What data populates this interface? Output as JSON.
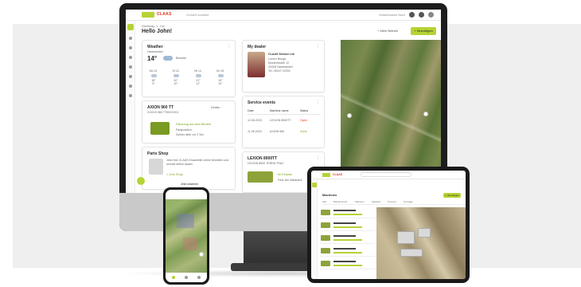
{
  "colors": {
    "accent": "#b5d334",
    "brand": "#e2311d",
    "bezel": "#1d1d1d"
  },
  "monitor": {
    "brand": "CLAAS",
    "topbar_text": "CLAAS connect",
    "topbar_right": "Vorkenbusch Nord",
    "greeting_small": "Samstag, 1. Juli",
    "greeting": "Hello John!",
    "btn_secondary": "+ Mein Betrieb",
    "btn_primary": "+ Hinzufügen",
    "weather": {
      "title": "Weather",
      "location": "Harsewinkel",
      "temp": "14°",
      "cond": "Bewölkt"
    },
    "weather_days": [
      {
        "day": "Mo 12.",
        "hi": "18°",
        "lo": "9°"
      },
      {
        "day": "Di 13.",
        "hi": "20°",
        "lo": "10°"
      },
      {
        "day": "Mi 14.",
        "hi": "21°",
        "lo": "11°"
      },
      {
        "day": "Do 15.",
        "hi": "19°",
        "lo": "10°"
      }
    ],
    "machine": {
      "title": "AXION 960 TT",
      "sub": "XXXXX 960 TT00XXX01",
      "status": "Parkposition",
      "link": "Details",
      "lime": "Fahrzeug auf dem Betrieb",
      "note": "Zuletzt aktiv vor 2 Std."
    },
    "parts": {
      "title": "Parts Shop",
      "text": "Jetzt Ihre CLAAS Ersatzteile online bestellen und schnell liefern lassen",
      "lime": "> Zum Shop",
      "button": "Jetzt ansehen"
    },
    "dealer": {
      "title": "My dealer",
      "name": "CLAAS Service Ltd",
      "lines": [
        "Lorenz Bouge",
        "Musterstraße 12",
        "33428 Harsewinkel",
        "Tel. 05247 12000"
      ]
    },
    "service": {
      "title": "Service events",
      "cols": [
        "Date",
        "Machine name",
        "Status"
      ],
      "rows": [
        [
          "12.06.2023",
          "LEXION 8900TT",
          "Open"
        ],
        [
          "11.05.2023",
          "AXION 960",
          "Done"
        ]
      ]
    },
    "lexion": {
      "title": "LEXION 8900TT",
      "sub": "LEXION 8900 TERRA TRAC",
      "status": "Im Einsatz",
      "note": "Feld: Am Waldrand"
    }
  },
  "tablet": {
    "brand": "CLAAS",
    "title": "Machines",
    "btn": "+ Hinzufügen",
    "tabs": [
      "Alle",
      "Mähdrescher",
      "Traktoren",
      "Häcksler",
      "Pressen",
      "Sonstige"
    ]
  }
}
